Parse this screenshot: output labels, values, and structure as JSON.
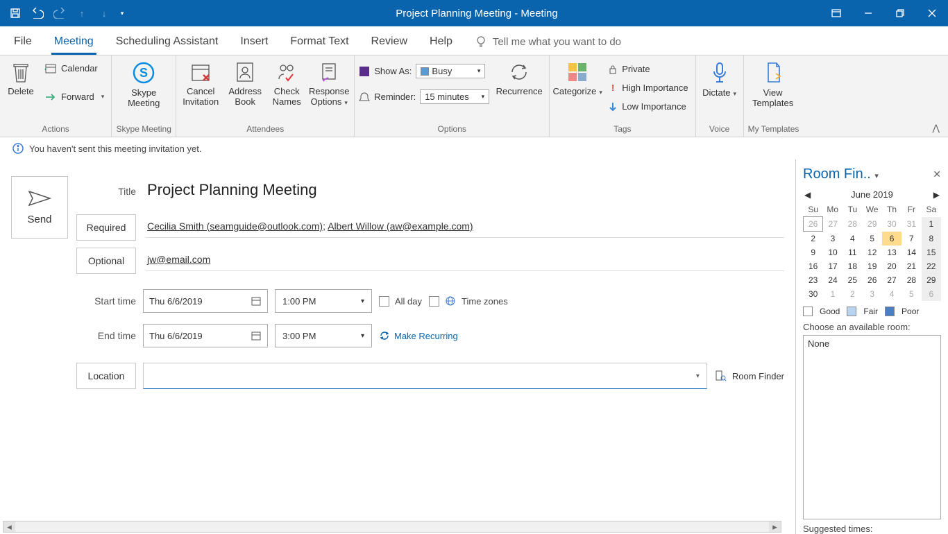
{
  "titlebar": {
    "title": "Project Planning Meeting  -  Meeting"
  },
  "tabs": {
    "file": "File",
    "meeting": "Meeting",
    "scheduling": "Scheduling Assistant",
    "insert": "Insert",
    "format": "Format Text",
    "review": "Review",
    "help": "Help",
    "tellme": "Tell me what you want to do"
  },
  "ribbon": {
    "actions": {
      "delete": "Delete",
      "calendar": "Calendar",
      "forward": "Forward",
      "label": "Actions"
    },
    "skype": {
      "btn": "Skype\nMeeting",
      "label": "Skype Meeting"
    },
    "attendees": {
      "cancel": "Cancel\nInvitation",
      "address": "Address\nBook",
      "check": "Check\nNames",
      "response": "Response\nOptions",
      "label": "Attendees"
    },
    "options": {
      "showas_lbl": "Show As:",
      "showas_val": "Busy",
      "reminder_lbl": "Reminder:",
      "reminder_val": "15 minutes",
      "recurrence": "Recurrence",
      "label": "Options"
    },
    "tags": {
      "categorize": "Categorize",
      "private": "Private",
      "high": "High Importance",
      "low": "Low Importance",
      "label": "Tags"
    },
    "voice": {
      "dictate": "Dictate",
      "label": "Voice"
    },
    "templates": {
      "view": "View\nTemplates",
      "label": "My Templates"
    }
  },
  "infobar": "You haven't sent this meeting invitation yet.",
  "compose": {
    "send": "Send",
    "title_lbl": "Title",
    "title": "Project Planning Meeting",
    "required_lbl": "Required",
    "recip1": "Cecilia Smith (seamguide@outlook.com)",
    "recip2": "Albert Willow (aw@example.com)",
    "optional_lbl": "Optional",
    "optional_val": "jw@email.com",
    "start_lbl": "Start time",
    "start_date": "Thu 6/6/2019",
    "start_time": "1:00 PM",
    "end_lbl": "End time",
    "end_date": "Thu 6/6/2019",
    "end_time": "3:00 PM",
    "allday": "All day",
    "timezones": "Time zones",
    "make_recurring": "Make Recurring",
    "location_lbl": "Location",
    "roomfinder_btn": "Room Finder"
  },
  "roomfinder": {
    "title": "Room Fin..",
    "month": "June 2019",
    "days": [
      "Su",
      "Mo",
      "Tu",
      "We",
      "Th",
      "Fr",
      "Sa"
    ],
    "weeks": [
      [
        {
          "d": "26",
          "c": "gray box"
        },
        {
          "d": "27",
          "c": "gray"
        },
        {
          "d": "28",
          "c": "gray"
        },
        {
          "d": "29",
          "c": "gray"
        },
        {
          "d": "30",
          "c": "gray"
        },
        {
          "d": "31",
          "c": "gray"
        },
        {
          "d": "1",
          "c": "sat"
        }
      ],
      [
        {
          "d": "2",
          "c": ""
        },
        {
          "d": "3",
          "c": ""
        },
        {
          "d": "4",
          "c": ""
        },
        {
          "d": "5",
          "c": ""
        },
        {
          "d": "6",
          "c": "sel"
        },
        {
          "d": "7",
          "c": ""
        },
        {
          "d": "8",
          "c": "sat"
        }
      ],
      [
        {
          "d": "9",
          "c": ""
        },
        {
          "d": "10",
          "c": ""
        },
        {
          "d": "11",
          "c": ""
        },
        {
          "d": "12",
          "c": ""
        },
        {
          "d": "13",
          "c": ""
        },
        {
          "d": "14",
          "c": ""
        },
        {
          "d": "15",
          "c": "sat"
        }
      ],
      [
        {
          "d": "16",
          "c": ""
        },
        {
          "d": "17",
          "c": ""
        },
        {
          "d": "18",
          "c": ""
        },
        {
          "d": "19",
          "c": ""
        },
        {
          "d": "20",
          "c": ""
        },
        {
          "d": "21",
          "c": ""
        },
        {
          "d": "22",
          "c": "sat"
        }
      ],
      [
        {
          "d": "23",
          "c": ""
        },
        {
          "d": "24",
          "c": ""
        },
        {
          "d": "25",
          "c": ""
        },
        {
          "d": "26",
          "c": ""
        },
        {
          "d": "27",
          "c": ""
        },
        {
          "d": "28",
          "c": ""
        },
        {
          "d": "29",
          "c": "sat"
        }
      ],
      [
        {
          "d": "30",
          "c": ""
        },
        {
          "d": "1",
          "c": "gray"
        },
        {
          "d": "2",
          "c": "gray"
        },
        {
          "d": "3",
          "c": "gray"
        },
        {
          "d": "4",
          "c": "gray"
        },
        {
          "d": "5",
          "c": "gray"
        },
        {
          "d": "6",
          "c": "gray sat"
        }
      ]
    ],
    "legend": {
      "good": "Good",
      "fair": "Fair",
      "poor": "Poor"
    },
    "choose": "Choose an available room:",
    "none": "None",
    "suggested": "Suggested times:"
  }
}
